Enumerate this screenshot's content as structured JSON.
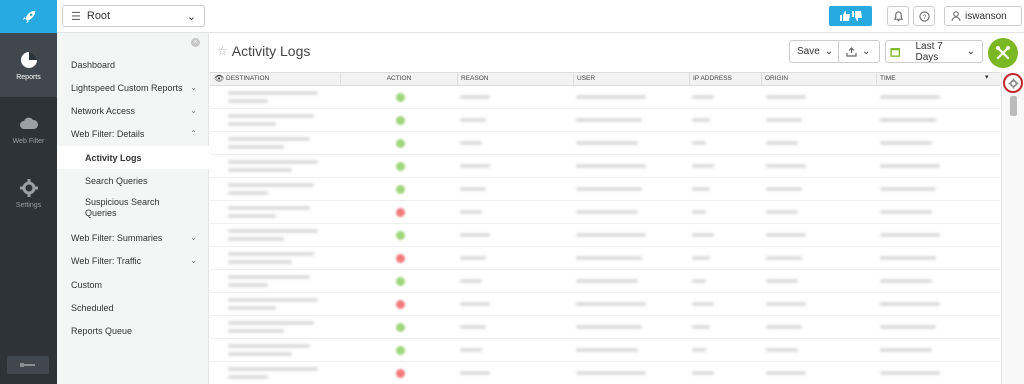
{
  "nav": {
    "items": [
      {
        "label": "Reports",
        "active": true
      },
      {
        "label": "Web Filter",
        "active": false
      },
      {
        "label": "Settings",
        "active": false
      }
    ]
  },
  "topbar": {
    "root_select": "Root",
    "username": "iswanson"
  },
  "sidebar": {
    "items": [
      {
        "label": "Dashboard"
      },
      {
        "label": "Lightspeed Custom Reports"
      },
      {
        "label": "Network Access"
      },
      {
        "label": "Web Filter: Details"
      },
      {
        "label": "Activity Logs"
      },
      {
        "label": "Search Queries"
      },
      {
        "label": "Suspicious Search Queries"
      },
      {
        "label": "Web Filter: Summaries"
      },
      {
        "label": "Web Filter: Traffic"
      },
      {
        "label": "Custom"
      },
      {
        "label": "Scheduled"
      },
      {
        "label": "Reports Queue"
      }
    ]
  },
  "main": {
    "title": "Activity Logs",
    "save_label": "Save",
    "date_range": "Last 7 Days",
    "columns": [
      "Destination",
      "Action",
      "Reason",
      "User",
      "IP Address",
      "Origin",
      "Time"
    ],
    "row_actions": [
      "allow",
      "allow",
      "allow",
      "allow",
      "allow",
      "block",
      "allow",
      "block",
      "allow",
      "block",
      "allow",
      "allow",
      "block"
    ],
    "colors": {
      "allow": "#9fd67a",
      "block": "#f07b7b",
      "accent": "#27aae1",
      "fab": "#7cb724",
      "highlight": "#c0262c"
    }
  }
}
